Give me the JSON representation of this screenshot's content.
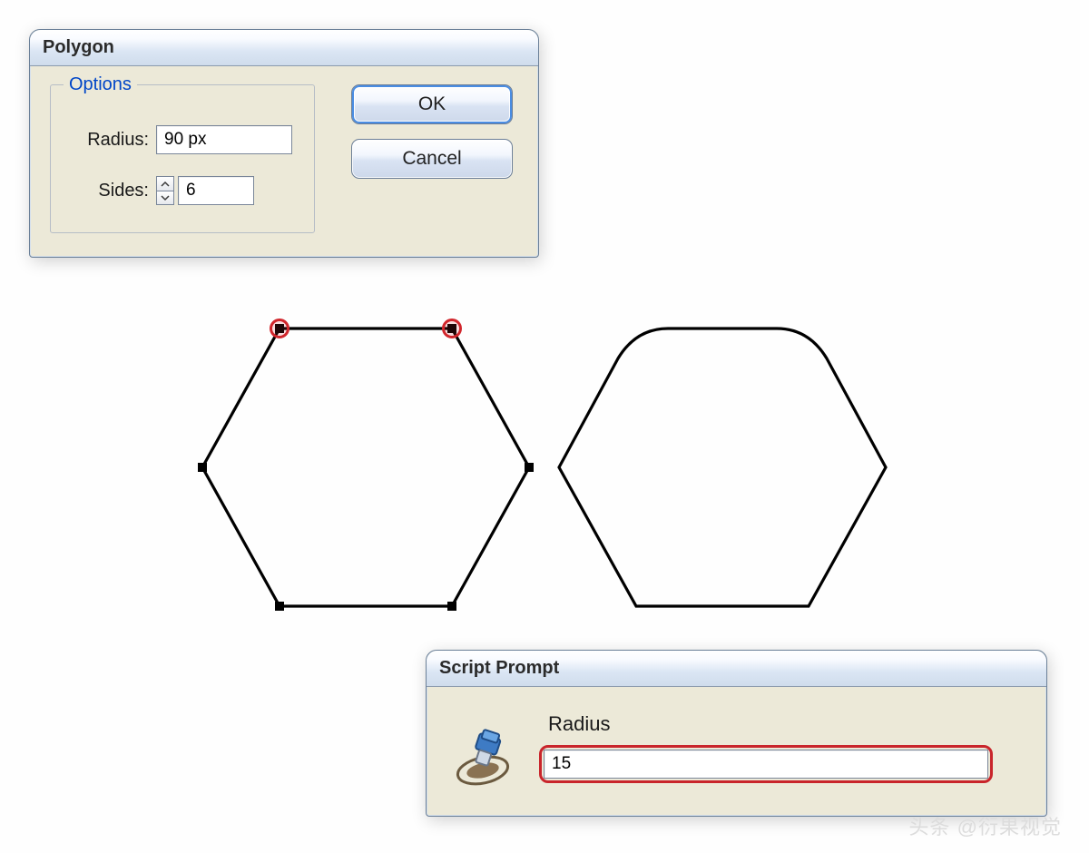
{
  "polygon_dialog": {
    "title": "Polygon",
    "options_legend": "Options",
    "radius_label": "Radius:",
    "radius_value": "90 px",
    "sides_label": "Sides:",
    "sides_value": "6",
    "ok_label": "OK",
    "cancel_label": "Cancel"
  },
  "script_prompt": {
    "title": "Script Prompt",
    "field_label": "Radius",
    "value": "15",
    "icon_name": "script-prompt-icon"
  },
  "watermark": "头条 @衍果视觉"
}
